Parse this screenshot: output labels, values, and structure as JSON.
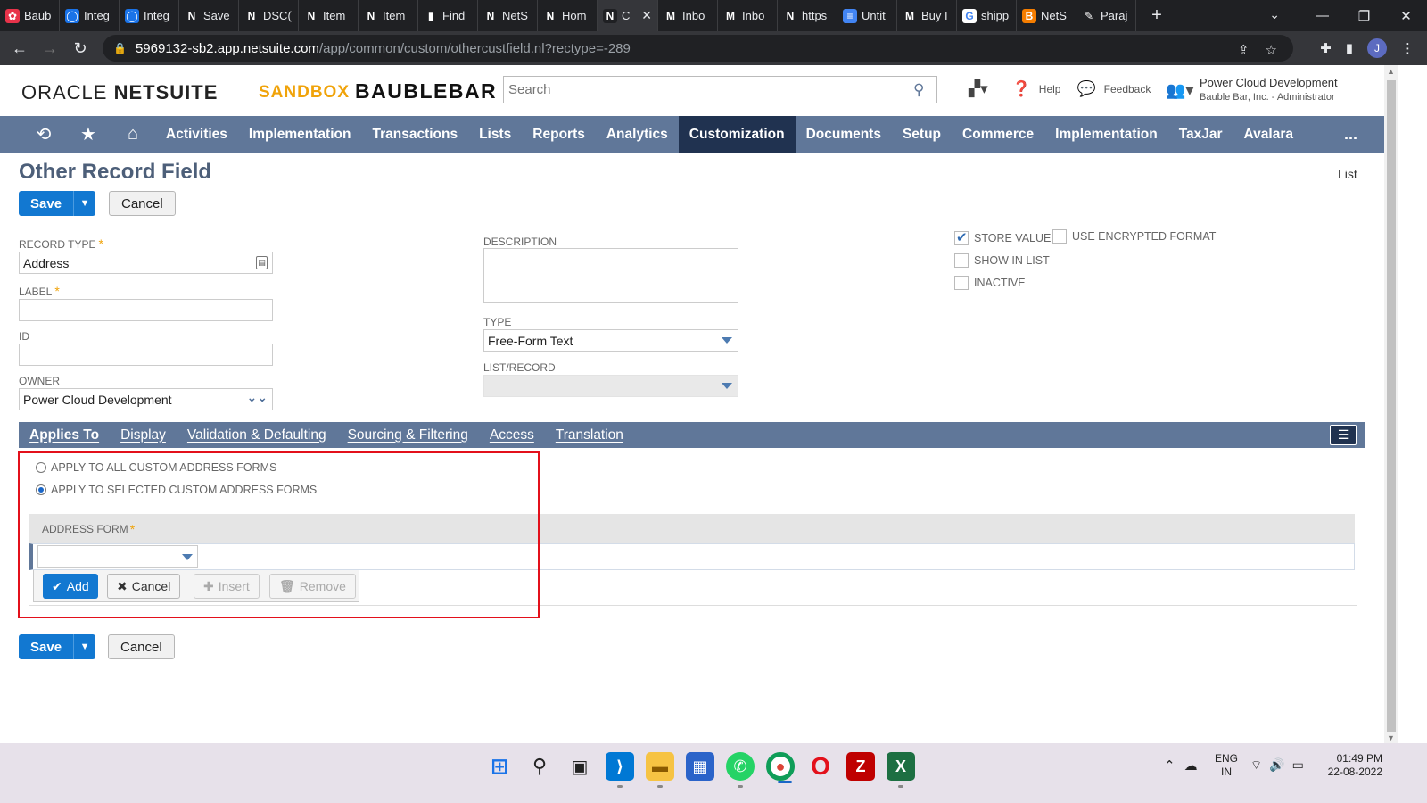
{
  "browser": {
    "tabs": [
      {
        "title": "Baub",
        "fav": "✿",
        "color": "#e8334a"
      },
      {
        "title": "Integ",
        "fav": "◯",
        "color": "#1a73e8"
      },
      {
        "title": "Integ",
        "fav": "◯",
        "color": "#1a73e8"
      },
      {
        "title": "Save",
        "fav": "N",
        "color": "#1f2023"
      },
      {
        "title": "DSC(",
        "fav": "N",
        "color": "#1f2023"
      },
      {
        "title": "Item",
        "fav": "N",
        "color": "#1f2023"
      },
      {
        "title": "Item",
        "fav": "N",
        "color": "#1f2023"
      },
      {
        "title": "Find",
        "fav": "▮",
        "color": "#1f2023"
      },
      {
        "title": "NetS",
        "fav": "N",
        "color": "#1f2023"
      },
      {
        "title": "Hom",
        "fav": "N",
        "color": "#1f2023"
      },
      {
        "title": "C",
        "fav": "N",
        "color": "#1f2023",
        "active": true
      },
      {
        "title": "Inbo",
        "fav": "M",
        "color": "#1f2023"
      },
      {
        "title": "Inbo",
        "fav": "M",
        "color": "#1f2023"
      },
      {
        "title": "https",
        "fav": "N",
        "color": "#1f2023"
      },
      {
        "title": "Untit",
        "fav": "≡",
        "color": "#4285f4"
      },
      {
        "title": "Buy I",
        "fav": "M",
        "color": "#1f2023"
      },
      {
        "title": "shipp",
        "fav": "G",
        "color": "#fff"
      },
      {
        "title": "NetS",
        "fav": "B",
        "color": "#f57d00"
      },
      {
        "title": "Paraj",
        "fav": "✎",
        "color": "#1f2023"
      }
    ],
    "url_host": "5969132-sb2.app.netsuite.com",
    "url_path": "/app/common/custom/othercustfield.nl?rectype=-289",
    "profile_initial": "J"
  },
  "header": {
    "oracle": "ORACLE",
    "netsuite": "NETSUITE",
    "sandbox": "SANDBOX",
    "company_logo": "BAUBLEBAR",
    "search_placeholder": "Search",
    "help": "Help",
    "feedback": "Feedback",
    "user_name": "Power Cloud Development",
    "user_role": "Bauble Bar, Inc. - Administrator"
  },
  "nav": {
    "items": [
      "Activities",
      "Implementation",
      "Transactions",
      "Lists",
      "Reports",
      "Analytics",
      "Customization",
      "Documents",
      "Setup",
      "Commerce",
      "Implementation",
      "TaxJar",
      "Avalara"
    ],
    "active": "Customization",
    "more": "..."
  },
  "page": {
    "title": "Other Record Field",
    "list_link": "List",
    "save": "Save",
    "cancel": "Cancel"
  },
  "form": {
    "record_type_label": "RECORD TYPE",
    "record_type_value": "Address",
    "label_label": "LABEL",
    "label_value": "",
    "id_label": "ID",
    "id_value": "",
    "owner_label": "OWNER",
    "owner_value": "Power Cloud Development",
    "description_label": "DESCRIPTION",
    "type_label": "TYPE",
    "type_value": "Free-Form Text",
    "list_record_label": "LIST/RECORD",
    "store_value": "STORE VALUE",
    "use_encrypted": "USE ENCRYPTED FORMAT",
    "show_in_list": "SHOW IN LIST",
    "inactive": "INACTIVE",
    "store_value_checked": true
  },
  "subtabs": {
    "items": [
      "Applies To",
      "Display",
      "Validation & Defaulting",
      "Sourcing & Filtering",
      "Access",
      "Translation"
    ],
    "active": "Applies To"
  },
  "applies_to": {
    "opt_all": "APPLY TO ALL CUSTOM ADDRESS FORMS",
    "opt_selected": "APPLY TO SELECTED CUSTOM ADDRESS FORMS",
    "selected_option": "opt_selected",
    "col_address_form": "ADDRESS FORM",
    "add": "Add",
    "cancel": "Cancel",
    "insert": "Insert",
    "remove": "Remove"
  },
  "taskbar": {
    "lang_top": "ENG",
    "lang_bottom": "IN",
    "time": "01:49 PM",
    "date": "22-08-2022"
  },
  "colors": {
    "nav_bg": "#607799",
    "nav_active": "#203250",
    "primary_button": "#1278d1",
    "highlight_box": "#e3101b",
    "sandbox": "#f0a30a"
  }
}
